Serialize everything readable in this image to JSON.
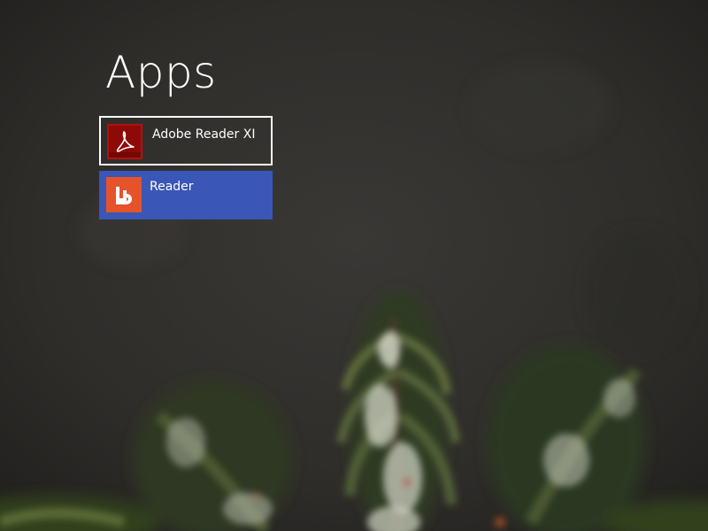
{
  "page": {
    "title": "Apps"
  },
  "apps": [
    {
      "label": "Adobe Reader XI",
      "icon": "acrobat-icon",
      "selected": true,
      "tile_color": "transparent",
      "icon_color": "#8e0a08"
    },
    {
      "label": "Reader",
      "icon": "windows-reader-icon",
      "selected": false,
      "tile_color": "#3a56b6",
      "icon_color": "#e5532b"
    }
  ],
  "colors": {
    "background": "#2a2826",
    "selection_border": "#ffffff",
    "text": "#ffffff"
  }
}
